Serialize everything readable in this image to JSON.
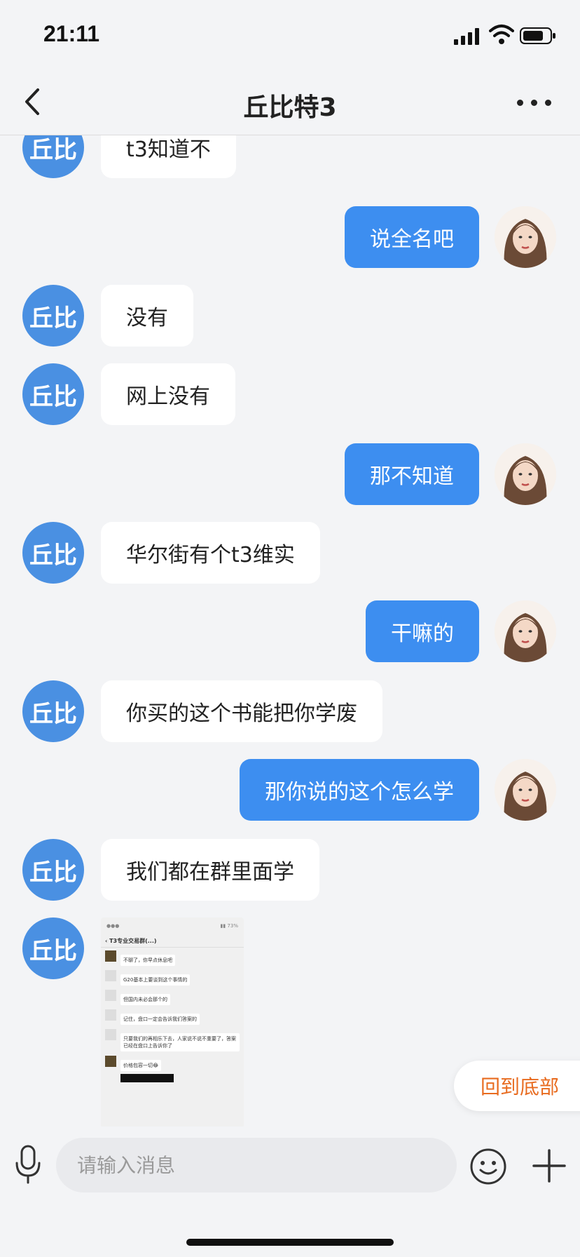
{
  "status": {
    "time": "21:11"
  },
  "header": {
    "title": "丘比特3"
  },
  "messages": [
    {
      "side": "left",
      "avatar": "丘比",
      "text": "t3知道不"
    },
    {
      "side": "right",
      "text": "说全名吧"
    },
    {
      "side": "left",
      "avatar": "丘比",
      "text": "没有"
    },
    {
      "side": "left",
      "avatar": "丘比",
      "text": "网上没有"
    },
    {
      "side": "right",
      "text": "那不知道"
    },
    {
      "side": "left",
      "avatar": "丘比",
      "text": "华尔街有个t3维实"
    },
    {
      "side": "right",
      "text": "干嘛的"
    },
    {
      "side": "left",
      "avatar": "丘比",
      "text": "你买的这个书能把你学废"
    },
    {
      "side": "right",
      "text": "那你说的这个怎么学"
    },
    {
      "side": "left",
      "avatar": "丘比",
      "text": "我们都在群里面学"
    },
    {
      "side": "left",
      "avatar": "丘比",
      "type": "image"
    }
  ],
  "image_preview": {
    "title": "T3专业交易群(...)",
    "lines": [
      "不聊了，你早点休息吧",
      "G20基本上要谈到这个事情的",
      "但国内未必会那个的",
      "记住，盘口一定会告诉我们答案的",
      "只要我们的再相乐下去，人家说不说不重要了，答案已经在盘口上告诉你了",
      "价格包容一切😂"
    ]
  },
  "back_to_bottom": "回到底部",
  "input": {
    "placeholder": "请输入消息"
  },
  "icons": {
    "back": "chevron-left-icon",
    "more": "more-dots-icon",
    "mic": "microphone-icon",
    "emoji": "smile-icon",
    "plus": "plus-icon"
  }
}
